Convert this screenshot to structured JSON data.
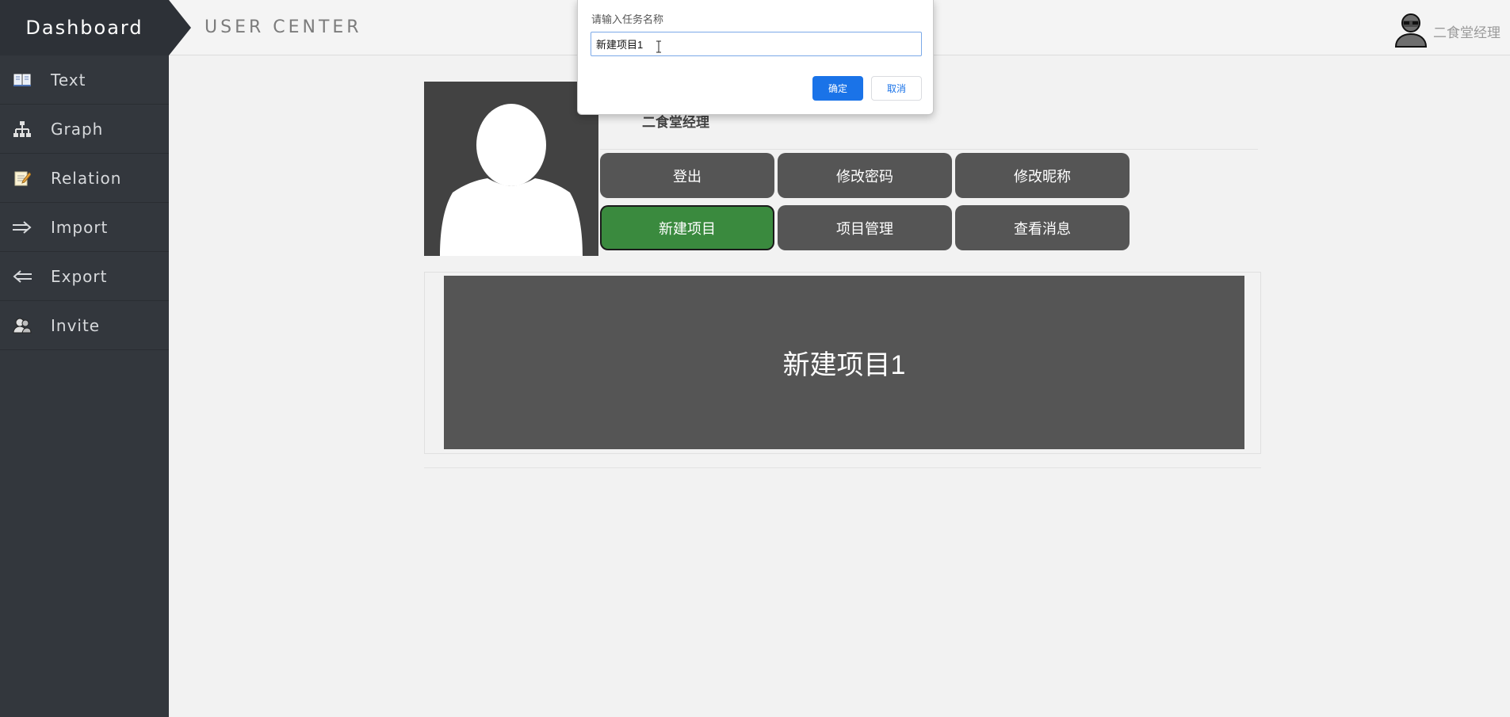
{
  "sidebar": {
    "brand": "Dashboard",
    "items": [
      {
        "label": "Text",
        "icon": "book-icon"
      },
      {
        "label": "Graph",
        "icon": "hierarchy-icon"
      },
      {
        "label": "Relation",
        "icon": "notepad-icon"
      },
      {
        "label": "Import",
        "icon": "arrow-right-icon"
      },
      {
        "label": "Export",
        "icon": "arrow-left-icon"
      },
      {
        "label": "Invite",
        "icon": "users-icon"
      }
    ]
  },
  "header": {
    "title": "USER CENTER",
    "user_name": "二食堂经理",
    "user_icon": "user-avatar-icon"
  },
  "profile": {
    "name": "二食堂经理",
    "avatar_icon": "person-silhouette-icon",
    "buttons": [
      {
        "label": "登出"
      },
      {
        "label": "修改密码"
      },
      {
        "label": "修改昵称"
      },
      {
        "label": "新建项目",
        "active": true
      },
      {
        "label": "项目管理"
      },
      {
        "label": "查看消息"
      }
    ]
  },
  "projects": [
    {
      "name": "新建项目1"
    }
  ],
  "dialog": {
    "title": "请输入任务名称",
    "input_value": "新建项目1",
    "ok_label": "确定",
    "cancel_label": "取消"
  },
  "colors": {
    "sidebar_bg": "#33373d",
    "button_bg": "#555555",
    "active_button_bg": "#3a8a3e",
    "dialog_ok": "#1a73e8"
  }
}
